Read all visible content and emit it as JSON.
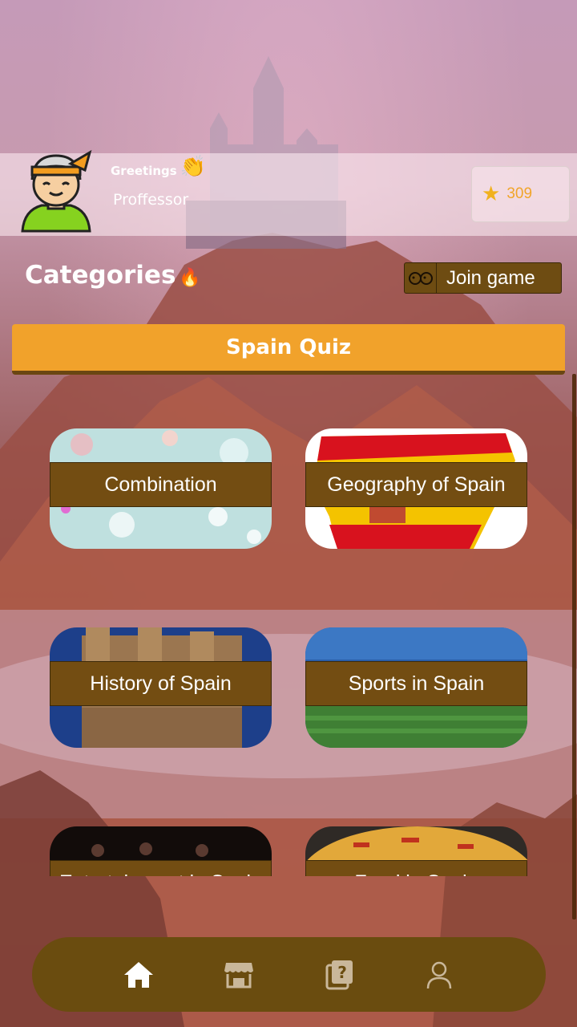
{
  "header": {
    "greeting": "Greetings",
    "greeting_emoji": "👏",
    "username": "Proffessor",
    "score": "309",
    "score_icon": "star-icon"
  },
  "categories": {
    "title": "Categories",
    "title_emoji": "🔥",
    "join_label": "Join game",
    "join_icon": "people-icon"
  },
  "quiz": {
    "title": "Spain Quiz"
  },
  "cards": [
    {
      "label": "Combination",
      "art": "bokeh-lights"
    },
    {
      "label": "Geography of Spain",
      "art": "spain-flag-map"
    },
    {
      "label": "History of Spain",
      "art": "castle"
    },
    {
      "label": "Sports in Spain",
      "art": "stadium"
    },
    {
      "label": "Entertainment in Spain",
      "art": "crowd"
    },
    {
      "label": "Food in Spain",
      "art": "paella"
    }
  ],
  "nav": [
    {
      "name": "home",
      "icon": "home-icon",
      "active": true
    },
    {
      "name": "store",
      "icon": "store-icon",
      "active": false
    },
    {
      "name": "quiz",
      "icon": "question-icon",
      "active": false
    },
    {
      "name": "profile",
      "icon": "user-icon",
      "active": false
    }
  ],
  "colors": {
    "accent": "#f1a22b",
    "brown": "#734d12",
    "nav_bg": "#6a4c0f",
    "score": "#f1a52a"
  }
}
